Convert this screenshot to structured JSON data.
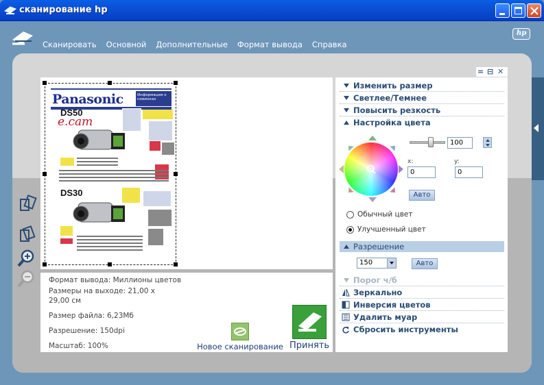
{
  "window": {
    "title": "сканирование hp"
  },
  "menu": [
    "Сканировать",
    "Основной",
    "Дополнительные",
    "Формат вывода",
    "Справка"
  ],
  "hp_logo": "hp",
  "preview": {
    "brand": "Panasonic",
    "brand_box": "Информация о новинках",
    "model1": "DS50",
    "model1_sub": "e.cam",
    "model2": "DS30"
  },
  "info": {
    "format": "Формат вывода: Миллионы цветов",
    "size_line1": "Размеры на выходе: 21,00 x",
    "size_line2": "29,00 см",
    "filesize": "Размер файла: 6,23Мб",
    "resolution": "Разрешение:  150dpi",
    "scale": "Масштаб: 100%"
  },
  "actions": {
    "new_scan": "Новое сканирование",
    "accept": "Принять"
  },
  "tools": {
    "resize": "Изменить размер",
    "brightness": "Светлее/Темнее",
    "sharpen": "Повысить резкость",
    "color": "Настройка цвета",
    "resolution": "Разрешение",
    "threshold": "Порог ч/б",
    "mirror": "Зеркально",
    "invert": "Инверсия цветов",
    "moire": "Удалить муар",
    "reset": "Сбросить инструменты"
  },
  "color_settings": {
    "saturation_value": "100",
    "x_label": "x:",
    "y_label": "y:",
    "x_value": "0",
    "y_value": "0",
    "auto_label": "Авто",
    "normal_color": "Обычный цвет",
    "enhanced_color": "Улучшенный цвет",
    "selected_mode": "enhanced"
  },
  "resolution_settings": {
    "value": "150",
    "auto_label": "Авто"
  },
  "colors": {
    "accent": "#2a4c74",
    "frame": "#6e96b9",
    "highlight": "#b8cfe6",
    "titlebar": "#0a4fd5"
  }
}
